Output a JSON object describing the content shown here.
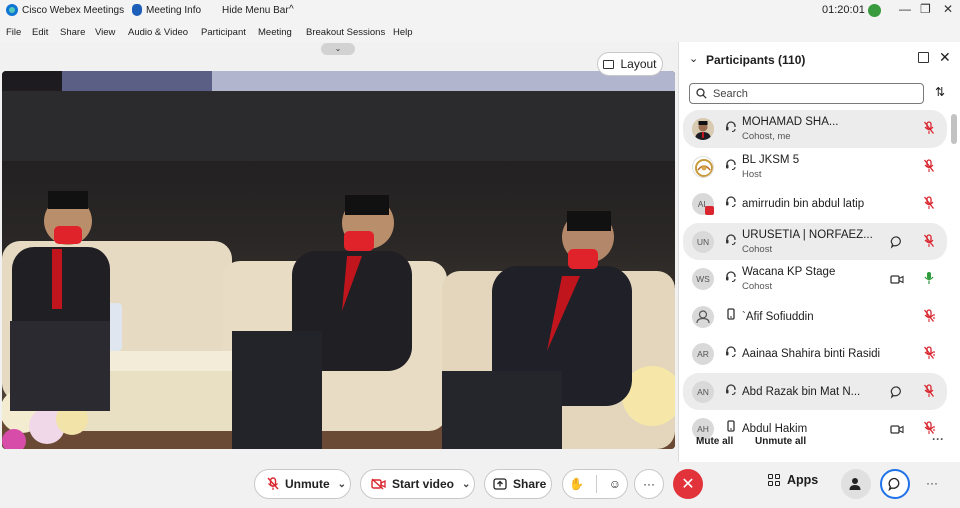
{
  "titlebar": {
    "app_name": "Cisco Webex Meetings",
    "meeting_info": "Meeting Info",
    "hide_menu": "Hide Menu Bar",
    "time": "01:20:01",
    "minimize": "—",
    "restore": "❐",
    "close": "✕"
  },
  "menu": [
    "File",
    "Edit",
    "Share",
    "View",
    "Audio & Video",
    "Participant",
    "Meeting",
    "Breakout Sessions",
    "Help"
  ],
  "layout_button": "Layout",
  "participants": {
    "title": "Participants (110)",
    "search_placeholder": "Search",
    "mute_all": "Mute all",
    "unmute_all": "Unmute all",
    "list": [
      {
        "name": "MOHAMAD SHA...",
        "role": "Cohost, me",
        "avatar": "",
        "avatar_type": "photo",
        "device": "headset-icon",
        "action": "",
        "mic": "muted",
        "selected": true
      },
      {
        "name": "BL JKSM 5",
        "role": "Host",
        "avatar": "",
        "avatar_type": "host",
        "device": "headset-icon",
        "action": "",
        "mic": "muted",
        "selected": false
      },
      {
        "name": "amirrudin bin abdul latip",
        "role": "",
        "avatar": "AL",
        "avatar_type": "initials",
        "device": "headset-icon",
        "action": "",
        "mic": "muted",
        "selected": false
      },
      {
        "name": "URUSETIA | NORFAEZ...",
        "role": "Cohost",
        "avatar": "UN",
        "avatar_type": "initials",
        "device": "headset-icon",
        "action": "chat-icon",
        "mic": "muted",
        "selected": true
      },
      {
        "name": "Wacana KP Stage",
        "role": "Cohost",
        "avatar": "WS",
        "avatar_type": "initials",
        "device": "headset-icon",
        "action": "camera-icon",
        "mic": "active",
        "selected": false
      },
      {
        "name": "`Afif Sofiuddin",
        "role": "",
        "avatar": "",
        "avatar_type": "user",
        "device": "phone-icon",
        "action": "",
        "mic": "muted-dots",
        "selected": false
      },
      {
        "name": "Aainaa Shahira binti Rasidi",
        "role": "",
        "avatar": "AR",
        "avatar_type": "initials",
        "device": "headset-icon",
        "action": "",
        "mic": "muted-dots",
        "selected": false
      },
      {
        "name": "Abd Razak bin Mat N...",
        "role": "",
        "avatar": "AN",
        "avatar_type": "initials",
        "device": "headset-icon",
        "action": "chat-icon",
        "mic": "muted",
        "selected": true
      },
      {
        "name": "Abdul Hakim",
        "role": "",
        "avatar": "AH",
        "avatar_type": "initials",
        "device": "phone-icon",
        "action": "camera-icon",
        "mic": "muted-dots",
        "selected": false
      }
    ]
  },
  "toolbar": {
    "unmute": "Unmute",
    "start_video": "Start video",
    "share": "Share",
    "apps": "Apps",
    "more": "···"
  },
  "colors": {
    "accent": "#1f72e8",
    "end_call": "#e2333b",
    "muted": "#d9252e",
    "active_mic": "#2f9a3b"
  }
}
